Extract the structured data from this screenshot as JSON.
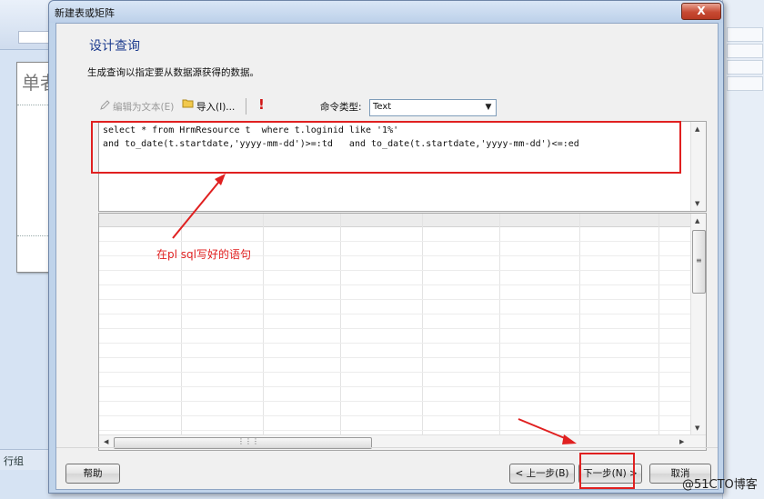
{
  "background_app": {
    "doc_title": "单者",
    "status_group": "行组"
  },
  "dialog": {
    "title": "新建表或矩阵",
    "close_label": "X",
    "heading": "设计查询",
    "subheading": "生成查询以指定要从数据源获得的数据。"
  },
  "toolbar": {
    "edit_as_text": "编辑为文本(E)",
    "import": "导入(I)...",
    "run_label": "!",
    "command_type_label": "命令类型:",
    "command_type_value": "Text"
  },
  "query": {
    "line1": "select * from HrmResource t  where t.loginid like '1%'",
    "line2": "and to_date(t.startdate,'yyyy-mm-dd')>=:td   and to_date(t.startdate,'yyyy-mm-dd')<=:ed"
  },
  "annotation": {
    "text": "在pl sql写好的语句"
  },
  "footer": {
    "help": "帮助",
    "prev": "< 上一步(B)",
    "next": "下一步(N) >",
    "cancel": "取消"
  },
  "watermark": "@51CTO博客",
  "colors": {
    "annotation_red": "#e02020",
    "heading_blue": "#1e3d8f",
    "close_red": "#c74a33"
  },
  "icons": {
    "edit": "pencil-icon",
    "import": "folder-open-icon",
    "run": "exclamation-icon",
    "dropdown": "chevron-down-icon"
  }
}
